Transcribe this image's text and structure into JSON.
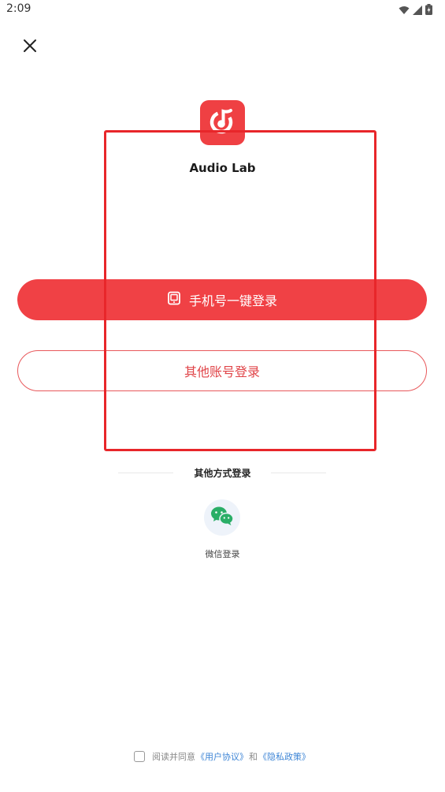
{
  "status_bar": {
    "time": "2:09",
    "icons": [
      "wifi-icon",
      "signal-icon",
      "battery-charging-icon"
    ]
  },
  "header": {
    "close_icon": "close-icon"
  },
  "app": {
    "name": "Audio Lab",
    "logo_icon": "music-note-logo-icon",
    "brand_color": "#ef4043"
  },
  "buttons": {
    "phone_login_label": "手机号一键登录",
    "phone_login_icon": "phone-icon",
    "other_account_label": "其他账号登录"
  },
  "other_methods": {
    "title": "其他方式登录",
    "wechat_label": "微信登录",
    "wechat_icon": "wechat-icon"
  },
  "agreement": {
    "prefix": "阅读并同意",
    "user_agreement": "《用户协议》",
    "conjunction": "和",
    "privacy_policy": "《隐私政策》",
    "checked": false
  },
  "colors": {
    "primary": "#f04145",
    "link": "#3f86d6",
    "highlight": "#e8262a"
  }
}
